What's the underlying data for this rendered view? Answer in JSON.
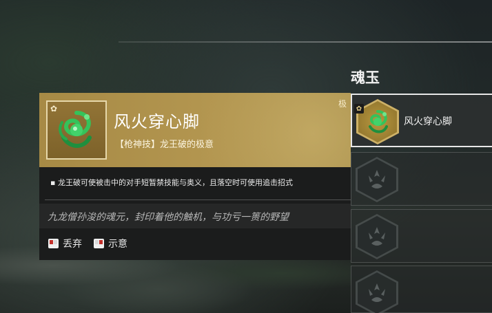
{
  "section_title": "魂玉",
  "tooltip": {
    "rarity": "极",
    "item_name": "风火穿心脚",
    "item_sub": "【枪神技】龙王破的极意",
    "effect": "▪ 龙王破可使被击中的对手短暂禁技能与奥义，且落空时可使用追击招式",
    "lore": "九龙僧孙浚的魂元，封印着他的触机，与功亏一篑的野望",
    "actions": [
      {
        "label": "丢弃",
        "icon": "mouse-left-icon"
      },
      {
        "label": "示意",
        "icon": "mouse-right-icon"
      }
    ]
  },
  "slots": [
    {
      "name": "风火穿心脚",
      "state": "equipped",
      "icon": "jade-serpent-icon"
    },
    {
      "name": "",
      "state": "empty",
      "icon": "lotus-emblem-icon"
    },
    {
      "name": "",
      "state": "empty",
      "icon": "lotus-emblem-icon"
    },
    {
      "name": "",
      "state": "empty",
      "icon": "lotus-emblem-icon"
    }
  ],
  "colors": {
    "gold": "#b39650",
    "jade": "#2fa84a",
    "panel": "#1b1c1c"
  }
}
